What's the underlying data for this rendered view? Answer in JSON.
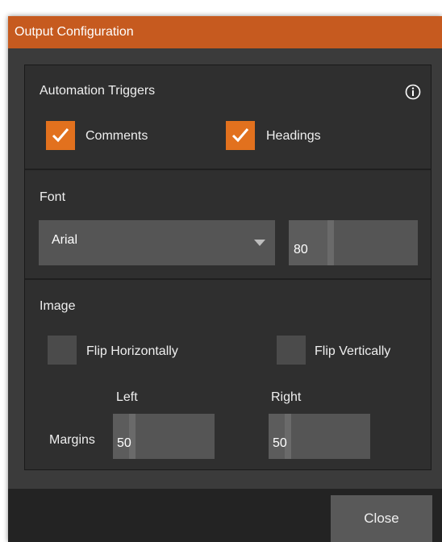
{
  "window": {
    "title": "Output Configuration"
  },
  "automation": {
    "section_label": "Automation Triggers",
    "comments": {
      "label": "Comments",
      "checked": true
    },
    "headings": {
      "label": "Headings",
      "checked": true
    }
  },
  "font": {
    "section_label": "Font",
    "family": "Arial",
    "size": "80"
  },
  "image": {
    "section_label": "Image",
    "flip_horizontal": {
      "label": "Flip Horizontally",
      "checked": false
    },
    "flip_vertical": {
      "label": "Flip Vertically",
      "checked": false
    },
    "margins_label": "Margins",
    "left": {
      "label": "Left",
      "value": "50"
    },
    "right": {
      "label": "Right",
      "value": "50"
    }
  },
  "footer": {
    "close_label": "Close"
  },
  "icons": {
    "info": "info-icon",
    "check": "checkmark-icon",
    "dropdown": "chevron-down-icon"
  },
  "colors": {
    "accent": "#c65a1f",
    "checkbox_checked": "#e2711e",
    "panel": "#2f2f2f"
  }
}
